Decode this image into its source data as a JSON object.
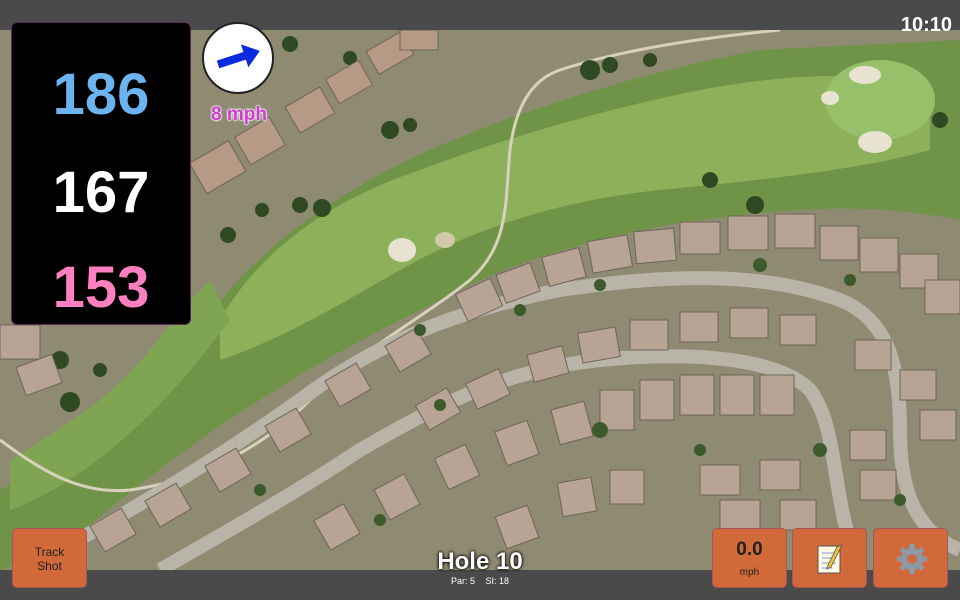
{
  "status": {
    "time": "10:10"
  },
  "yardages": {
    "back": "186",
    "middle": "167",
    "front": "153"
  },
  "wind": {
    "speed": "8 mph",
    "icon": "arrow-right-icon"
  },
  "buttons": {
    "track_shot_line1": "Track",
    "track_shot_line2": "Shot",
    "speed_value": "0.0",
    "speed_unit": "mph",
    "notes_icon": "notepad-icon",
    "settings_icon": "gear-icon"
  },
  "hole": {
    "title": "Hole 10",
    "par": "Par: 5",
    "si": "SI: 18"
  },
  "colors": {
    "back": "#6cb4f0",
    "middle": "#ffffff",
    "front": "#ff80c0",
    "wind_speed": "#d03cd0",
    "button": "#d2693a"
  }
}
